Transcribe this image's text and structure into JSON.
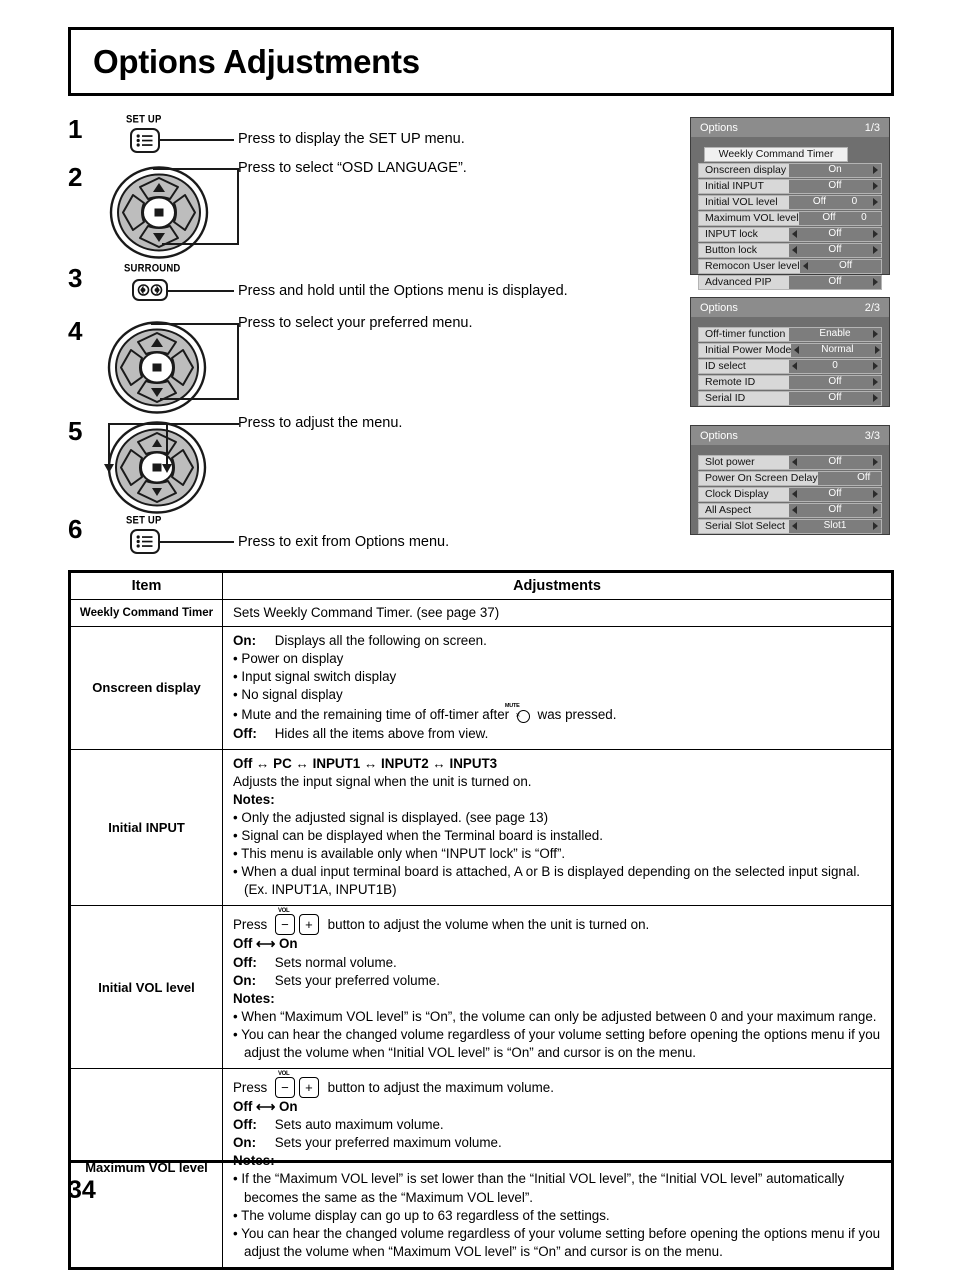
{
  "page": {
    "title": "Options Adjustments",
    "page_number": "34"
  },
  "steps": [
    {
      "num": "1",
      "key_label": "SET UP",
      "key_icon": "menu-list-icon",
      "text": "Press to display the SET UP menu."
    },
    {
      "num": "2",
      "key_label": "",
      "key_icon": "dpad-updown-icon",
      "text": "Press to select “OSD LANGUAGE”."
    },
    {
      "num": "3",
      "key_label": "SURROUND",
      "key_icon": "surround-icon",
      "text": "Press and hold until the Options menu is displayed."
    },
    {
      "num": "4",
      "key_label": "",
      "key_icon": "dpad-updown-icon",
      "text": "Press to select your preferred menu."
    },
    {
      "num": "5",
      "key_label": "",
      "key_icon": "dpad-leftright-icon",
      "text": "Press to adjust the menu."
    },
    {
      "num": "6",
      "key_label": "SET UP",
      "key_icon": "menu-list-icon",
      "text": "Press to exit from Options menu."
    }
  ],
  "osd_panels": [
    {
      "title": "Options",
      "page": "1/3",
      "rows": [
        {
          "label": "Weekly Command Timer",
          "type": "full"
        },
        {
          "label": "Onscreen display",
          "value": "On",
          "left_arrow": false,
          "right_arrow": true
        },
        {
          "label": "Initial INPUT",
          "value": "Off",
          "left_arrow": false,
          "right_arrow": true
        },
        {
          "label": "Initial VOL level",
          "value": "Off",
          "value2": "0",
          "left_arrow": false,
          "right_arrow": true
        },
        {
          "label": "Maximum VOL level",
          "value": "Off",
          "value2": "0",
          "left_arrow": false,
          "right_arrow": true
        },
        {
          "label": "INPUT lock",
          "value": "Off",
          "left_arrow": true,
          "right_arrow": true
        },
        {
          "label": "Button lock",
          "value": "Off",
          "left_arrow": true,
          "right_arrow": true
        },
        {
          "label": "Remocon User level",
          "value": "Off",
          "left_arrow": true,
          "right_arrow": true
        },
        {
          "label": "Advanced PIP",
          "value": "Off",
          "left_arrow": false,
          "right_arrow": true
        }
      ]
    },
    {
      "title": "Options",
      "page": "2/3",
      "rows": [
        {
          "label": "Off-timer function",
          "value": "Enable",
          "left_arrow": false,
          "right_arrow": true
        },
        {
          "label": "Initial Power Mode",
          "value": "Normal",
          "left_arrow": true,
          "right_arrow": true
        },
        {
          "label": "ID select",
          "value": "0",
          "left_arrow": true,
          "right_arrow": true
        },
        {
          "label": "Remote ID",
          "value": "Off",
          "left_arrow": false,
          "right_arrow": true
        },
        {
          "label": "Serial ID",
          "value": "Off",
          "left_arrow": false,
          "right_arrow": true
        }
      ]
    },
    {
      "title": "Options",
      "page": "3/3",
      "rows": [
        {
          "label": "Slot power",
          "value": "Off",
          "left_arrow": true,
          "right_arrow": true
        },
        {
          "label": "Power On Screen Delay",
          "value": "Off",
          "left_arrow": false,
          "right_arrow": true
        },
        {
          "label": "Clock Display",
          "value": "Off",
          "left_arrow": true,
          "right_arrow": true
        },
        {
          "label": "All Aspect",
          "value": "Off",
          "left_arrow": true,
          "right_arrow": true
        },
        {
          "label": "Serial Slot Select",
          "value": "Slot1",
          "left_arrow": true,
          "right_arrow": true
        }
      ]
    }
  ],
  "table": {
    "header": {
      "item": "Item",
      "adjustments": "Adjustments"
    },
    "rows": [
      {
        "item": "Weekly Command Timer",
        "item_small": true,
        "lines": [
          {
            "kind": "plain",
            "text": "Sets Weekly Command Timer. (see page 37)"
          }
        ]
      },
      {
        "item": "Onscreen display",
        "lines": [
          {
            "kind": "kv",
            "key": "On:",
            "text": "Displays all the following on screen."
          },
          {
            "kind": "bullet",
            "text": "Power on display"
          },
          {
            "kind": "bullet",
            "text": "Input signal switch display"
          },
          {
            "kind": "bullet",
            "text": "No signal display"
          },
          {
            "kind": "bullet-mute",
            "text_before": "Mute and the remaining time of off-timer after",
            "text_after": "was pressed."
          },
          {
            "kind": "kv",
            "key": "Off:",
            "text": "Hides all the items above from view."
          }
        ]
      },
      {
        "item": "Initial INPUT",
        "lines": [
          {
            "kind": "bold",
            "text": "Off ↔ PC ↔ INPUT1 ↔ INPUT2 ↔ INPUT3"
          },
          {
            "kind": "plain",
            "text": "Adjusts the input signal when the unit is turned on."
          },
          {
            "kind": "bold",
            "text": "Notes:"
          },
          {
            "kind": "bullet",
            "text": "Only the adjusted signal is displayed. (see page 13)"
          },
          {
            "kind": "bullet",
            "text": "Signal can be displayed when the Terminal board is installed."
          },
          {
            "kind": "bullet",
            "text": "This menu is available only when “INPUT lock” is “Off”."
          },
          {
            "kind": "bullet",
            "text": "When a dual input terminal board is attached, A or B is displayed depending on the selected input signal. (Ex. INPUT1A, INPUT1B)"
          }
        ]
      },
      {
        "item": "Initial VOL level",
        "lines": [
          {
            "kind": "volpress",
            "text_before": "Press",
            "text_after": "button to adjust the volume when the unit is turned on.",
            "vol_cap": "VOL"
          },
          {
            "kind": "bold",
            "text": "Off ⟷ On"
          },
          {
            "kind": "kv",
            "key": "Off:",
            "text": "Sets normal volume."
          },
          {
            "kind": "kv",
            "key": "On:",
            "text": "Sets your preferred volume."
          },
          {
            "kind": "bold",
            "text": "Notes:"
          },
          {
            "kind": "bullet",
            "text": "When “Maximum VOL level” is “On”, the volume can only be adjusted between 0 and your maximum range."
          },
          {
            "kind": "bullet",
            "text": "You can hear the changed volume regardless of your volume setting before opening the options menu if you adjust the volume when “Initial VOL level” is “On” and cursor is on the menu."
          }
        ]
      },
      {
        "item": "Maximum VOL level",
        "lines": [
          {
            "kind": "volpress",
            "text_before": "Press",
            "text_after": "button to adjust the maximum volume.",
            "vol_cap": "VOL"
          },
          {
            "kind": "bold",
            "text": "Off ⟷ On"
          },
          {
            "kind": "kv",
            "key": "Off:",
            "text": "Sets auto maximum volume."
          },
          {
            "kind": "kv",
            "key": "On:",
            "text": "Sets your preferred maximum volume."
          },
          {
            "kind": "bold",
            "text": "Notes:"
          },
          {
            "kind": "bullet",
            "text": "If the “Maximum VOL level” is set lower than the “Initial VOL level”, the “Initial VOL level” automatically becomes the same as the “Maximum VOL level”."
          },
          {
            "kind": "bullet",
            "text": "The volume display can go up to 63 regardless of the settings."
          },
          {
            "kind": "bullet",
            "text": "You can hear the changed volume regardless of your volume setting before opening the options menu if you adjust the volume when “Maximum VOL level” is “On” and cursor is on the menu."
          }
        ]
      }
    ]
  },
  "colors": {
    "osd_title_bar": "#8c8c8c",
    "osd_background": "#6f6f6f",
    "osd_row_label": "#d8d8d8",
    "osd_row_value": "#7d7d7d",
    "dpad_fill": "#bdbdbd",
    "ink": "#000000"
  }
}
